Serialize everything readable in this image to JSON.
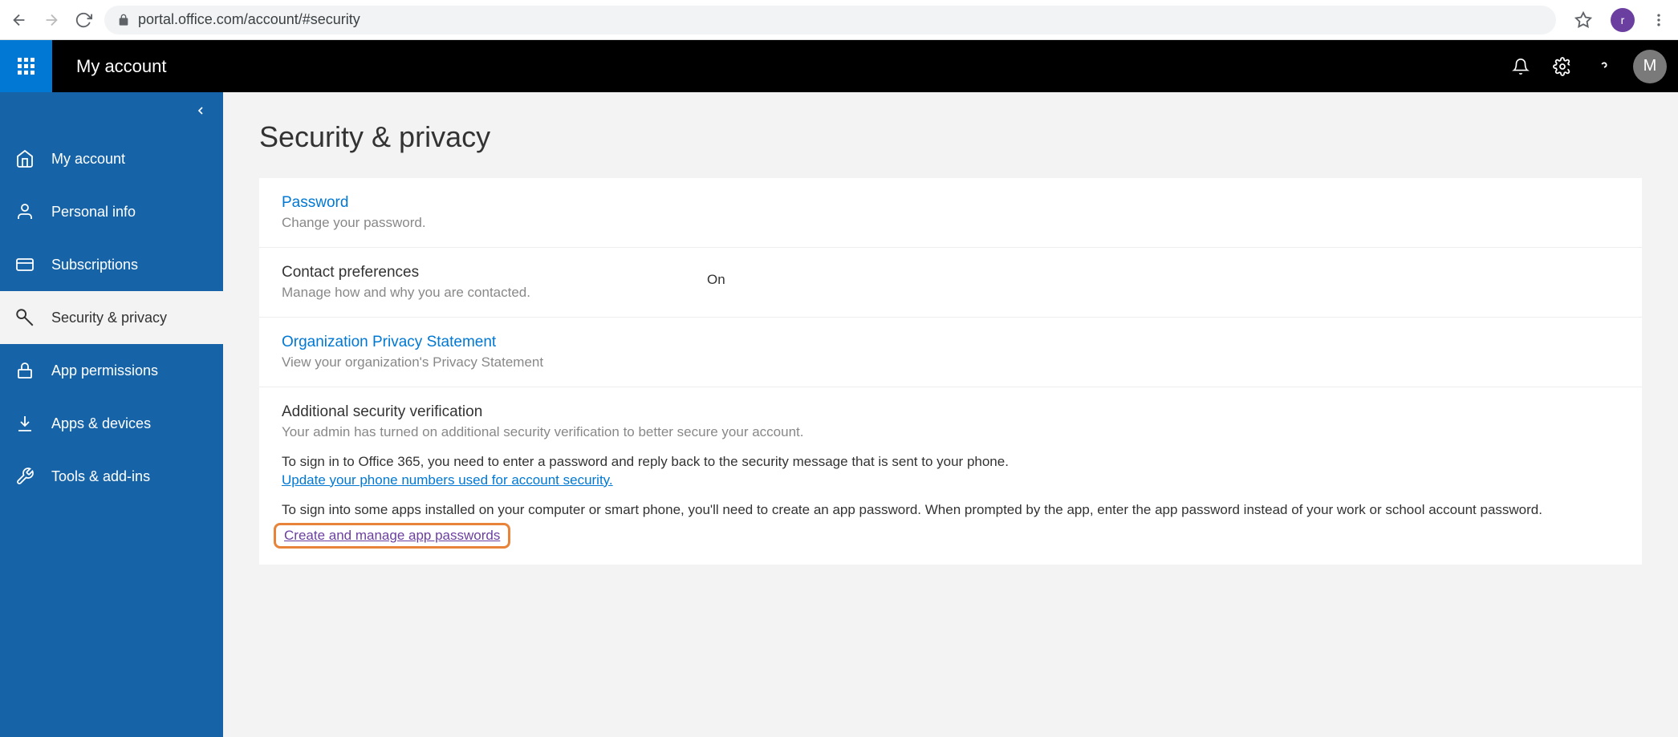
{
  "browser": {
    "url": "portal.office.com/account/#security",
    "profile_letter": "r"
  },
  "header": {
    "title": "My account",
    "avatar_letter": "M"
  },
  "sidebar": {
    "items": [
      {
        "label": "My account"
      },
      {
        "label": "Personal info"
      },
      {
        "label": "Subscriptions"
      },
      {
        "label": "Security & privacy"
      },
      {
        "label": "App permissions"
      },
      {
        "label": "Apps & devices"
      },
      {
        "label": "Tools & add-ins"
      }
    ]
  },
  "main": {
    "title": "Security & privacy",
    "sections": {
      "password": {
        "title": "Password",
        "desc": "Change your password."
      },
      "contact": {
        "title": "Contact preferences",
        "desc": "Manage how and why you are contacted.",
        "value": "On"
      },
      "org": {
        "title": "Organization Privacy Statement",
        "desc": "View your organization's Privacy Statement"
      },
      "additional": {
        "title": "Additional security verification",
        "desc": "Your admin has turned on additional security verification to better secure your account.",
        "line1": "To sign in to Office 365, you need to enter a password and reply back to the security message that is sent to your phone.",
        "link1": "Update your phone numbers used for account security.",
        "line2": "To sign into some apps installed on your computer or smart phone, you'll need to create an app password. When prompted by the app, enter the app password instead of your work or school account password.",
        "link2": "Create and manage app passwords"
      }
    }
  }
}
